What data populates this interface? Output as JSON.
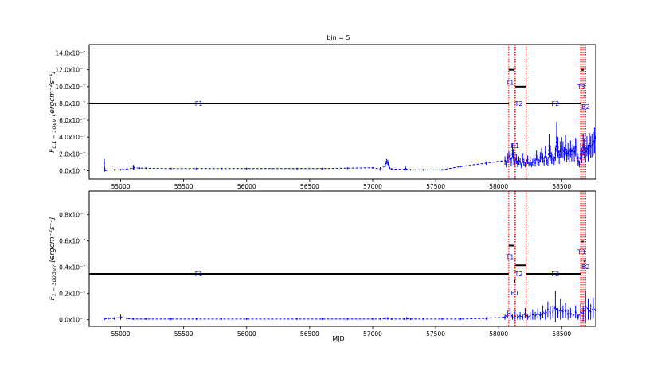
{
  "figure": {
    "title": "bin = 5",
    "xlabel": "MJD"
  },
  "colors": {
    "light_curve": "#0000ff",
    "flux_levels": "#000000",
    "period_markers": "#ff0000",
    "period_labels": "#0000ff",
    "background": "#ffffff"
  },
  "chart_data": [
    {
      "type": "line",
      "name": "top",
      "ylabel": "F_{0.1-1GeV} [erg cm^{-2} s^{-1}]",
      "ylabel_main": "F",
      "ylabel_sub": "0.1 − 1GeV",
      "ylabel_unit": "[ergcm⁻²s⁻¹]",
      "xlim": [
        54750,
        58770
      ],
      "ylim": [
        -1.0,
        15.0
      ],
      "y_scale_note": "×10⁻⁷",
      "yticks": [
        0,
        2,
        4,
        6,
        8,
        10,
        12,
        14
      ],
      "ytick_labels": [
        "0.0x10⁻⁷",
        "2.0x10⁻⁷",
        "4.0x10⁻⁷",
        "6.0x10⁻⁷",
        "8.0x10⁻⁷",
        "10.0x10⁻⁷",
        "12.0x10⁻⁷",
        "14.0x10⁻⁷"
      ],
      "xticks": [
        55000,
        55500,
        56000,
        56500,
        57000,
        57500,
        58000,
        58500
      ],
      "xtick_labels": [
        "55000",
        "55500",
        "56000",
        "56500",
        "57000",
        "57500",
        "58000",
        "58500"
      ],
      "levels": [
        {
          "label": "F1",
          "x0": 54750,
          "x1": 58080,
          "y": 8.0,
          "label_x": 55620,
          "label_y": 8.0
        },
        {
          "label": "T1",
          "x0": 58080,
          "x1": 58125,
          "y": 12.0,
          "label_x": 58090,
          "label_y": 10.5
        },
        {
          "label": "B1",
          "x0": 58125,
          "x1": 58132,
          "y": 5.0,
          "label_x": 58130,
          "label_y": 3.0
        },
        {
          "label": "T2",
          "x0": 58132,
          "x1": 58218,
          "y": 10.0,
          "label_x": 58160,
          "label_y": 8.0
        },
        {
          "label": "F2",
          "x0": 58218,
          "x1": 58650,
          "y": 8.0,
          "label_x": 58450,
          "label_y": 8.0
        },
        {
          "label": "T3",
          "x0": 58650,
          "x1": 58675,
          "y": 12.0,
          "label_x": 58655,
          "label_y": 10.0
        },
        {
          "label": "B2",
          "x0": 58675,
          "x1": 58690,
          "y": 8.9,
          "label_x": 58690,
          "label_y": 7.6
        }
      ],
      "vlines": [
        58080,
        58125,
        58132,
        58218,
        58650,
        58662,
        58675,
        58690
      ],
      "series": [
        {
          "style": "dashed-with-errorbars",
          "x": [
            54870,
            54872,
            54874,
            54880,
            54950,
            55000,
            55050,
            55100,
            55102,
            55104,
            55150,
            55200,
            55400,
            55600,
            55800,
            56000,
            56200,
            56400,
            56600,
            56800,
            57000,
            57060,
            57100,
            57110,
            57120,
            57125,
            57130,
            57135,
            57150,
            57250,
            57260,
            57270,
            57300,
            57400,
            57550,
            57700,
            57900,
            58050,
            58060,
            58070,
            58080,
            58090,
            58100,
            58110,
            58115,
            58120,
            58125,
            58130,
            58140,
            58150,
            58160,
            58170,
            58180,
            58190,
            58200,
            58210,
            58220,
            58230,
            58240,
            58250,
            58260,
            58270,
            58280,
            58290,
            58300,
            58310,
            58320,
            58330,
            58340,
            58350,
            58360,
            58370,
            58380,
            58390,
            58400,
            58410,
            58420,
            58430,
            58440,
            58450,
            58460,
            58470,
            58480,
            58490,
            58500,
            58510,
            58520,
            58530,
            58540,
            58550,
            58560,
            58570,
            58580,
            58590,
            58600,
            58610,
            58620,
            58630,
            58640,
            58650,
            58660,
            58670,
            58680,
            58690,
            58700,
            58710,
            58720,
            58730,
            58740,
            58750,
            58760,
            58770
          ],
          "y": [
            0.9,
            0.2,
            0.1,
            0.05,
            0.1,
            0.1,
            0.2,
            0.3,
            0.4,
            0.35,
            0.3,
            0.3,
            0.25,
            0.25,
            0.25,
            0.25,
            0.25,
            0.25,
            0.25,
            0.3,
            0.35,
            0.2,
            0.6,
            1.1,
            1.0,
            0.8,
            0.5,
            0.3,
            0.2,
            0.15,
            0.3,
            0.15,
            0.1,
            0.1,
            0.1,
            0.5,
            0.9,
            1.2,
            0.8,
            1.5,
            1.6,
            1.8,
            1.0,
            2.4,
            2.0,
            1.2,
            0.9,
            1.2,
            1.4,
            0.8,
            1.2,
            1.1,
            0.6,
            1.5,
            1.0,
            0.7,
            1.0,
            1.3,
            0.8,
            1.2,
            0.7,
            1.0,
            1.4,
            0.9,
            1.8,
            1.2,
            1.0,
            1.6,
            2.0,
            1.5,
            1.1,
            2.2,
            1.2,
            1.0,
            3.0,
            2.1,
            1.5,
            1.4,
            1.2,
            2.0,
            4.0,
            2.8,
            1.6,
            2.5,
            2.8,
            2.5,
            2.0,
            3.0,
            1.8,
            2.3,
            1.8,
            2.6,
            1.9,
            3.0,
            2.0,
            2.8,
            2.5,
            1.2,
            0.8,
            2.3,
            1.8,
            3.1,
            2.6,
            1.9,
            2.9,
            2.1,
            3.2,
            2.8,
            3.0,
            3.2,
            3.6,
            4.1
          ],
          "yerr": [
            0.5,
            0.3,
            0.2,
            0.1,
            0.1,
            0.1,
            0.1,
            0.2,
            0.3,
            0.2,
            0.1,
            0.1,
            0.1,
            0.1,
            0.1,
            0.1,
            0.1,
            0.1,
            0.1,
            0.1,
            0.1,
            0.2,
            0.2,
            0.3,
            0.3,
            0.2,
            0.2,
            0.1,
            0.1,
            0.1,
            0.3,
            0.1,
            0.1,
            0.1,
            0.1,
            0.1,
            0.2,
            0.5,
            0.4,
            0.6,
            0.7,
            0.6,
            0.5,
            0.8,
            0.6,
            0.5,
            0.4,
            0.5,
            0.6,
            0.4,
            0.5,
            0.4,
            0.3,
            0.6,
            0.4,
            0.3,
            0.4,
            0.5,
            0.3,
            0.5,
            0.3,
            0.4,
            0.5,
            0.4,
            0.6,
            0.5,
            0.4,
            0.6,
            0.7,
            0.6,
            0.5,
            0.7,
            0.5,
            0.4,
            1.4,
            0.9,
            0.7,
            0.6,
            0.5,
            0.8,
            1.8,
            1.2,
            0.8,
            1.0,
            1.2,
            1.0,
            0.8,
            1.2,
            0.8,
            1.0,
            0.8,
            1.0,
            0.8,
            1.2,
            0.9,
            1.1,
            1.2,
            0.6,
            0.4,
            1.0,
            0.9,
            1.3,
            1.2,
            0.9,
            1.2,
            1.0,
            1.3,
            1.3,
            1.4,
            1.4,
            1.5,
            1.6
          ]
        }
      ]
    },
    {
      "type": "line",
      "name": "bottom",
      "ylabel": "F_{1-300GeV} [erg cm^{-2} s^{-1}]",
      "ylabel_main": "F",
      "ylabel_sub": "1 − 300GeV",
      "ylabel_unit": "[ergcm⁻²s⁻¹]",
      "xlim": [
        54750,
        58770
      ],
      "ylim": [
        -0.05,
        0.98
      ],
      "y_scale_note": "×10⁻⁷",
      "yticks": [
        0.0,
        0.2,
        0.4,
        0.6,
        0.8
      ],
      "ytick_labels": [
        "0.0x10⁻⁷",
        "0.2x10⁻⁷",
        "0.4x10⁻⁷",
        "0.6x10⁻⁷",
        "0.8x10⁻⁷"
      ],
      "xticks": [
        55000,
        55500,
        56000,
        56500,
        57000,
        57500,
        58000,
        58500
      ],
      "xtick_labels": [
        "55000",
        "55500",
        "56000",
        "56500",
        "57000",
        "57500",
        "58000",
        "58500"
      ],
      "levels": [
        {
          "label": "F1",
          "x0": 54750,
          "x1": 58080,
          "y": 0.35,
          "label_x": 55620,
          "label_y": 0.35
        },
        {
          "label": "T1",
          "x0": 58080,
          "x1": 58125,
          "y": 0.565,
          "label_x": 58090,
          "label_y": 0.48
        },
        {
          "label": "B1",
          "x0": 58125,
          "x1": 58132,
          "y": 0.295,
          "label_x": 58130,
          "label_y": 0.205
        },
        {
          "label": "T2",
          "x0": 58132,
          "x1": 58218,
          "y": 0.415,
          "label_x": 58160,
          "label_y": 0.35
        },
        {
          "label": "F2",
          "x0": 58218,
          "x1": 58650,
          "y": 0.35,
          "label_x": 58450,
          "label_y": 0.35
        },
        {
          "label": "T3",
          "x0": 58650,
          "x1": 58675,
          "y": 0.595,
          "label_x": 58655,
          "label_y": 0.515
        },
        {
          "label": "B2",
          "x0": 58675,
          "x1": 58690,
          "y": 0.445,
          "label_x": 58690,
          "label_y": 0.405
        }
      ],
      "vlines": [
        58080,
        58125,
        58132,
        58218,
        58650,
        58662,
        58675,
        58690
      ],
      "series": [
        {
          "style": "dashed-with-errorbars",
          "x": [
            54870,
            54900,
            54950,
            55000,
            55050,
            55100,
            55200,
            55400,
            55600,
            55800,
            56000,
            56200,
            56400,
            56600,
            56800,
            57000,
            57060,
            57100,
            57120,
            57150,
            57250,
            57270,
            57300,
            57400,
            57550,
            57700,
            57900,
            58050,
            58070,
            58090,
            58110,
            58130,
            58150,
            58170,
            58190,
            58210,
            58230,
            58250,
            58270,
            58290,
            58310,
            58330,
            58350,
            58370,
            58390,
            58410,
            58430,
            58450,
            58470,
            58490,
            58510,
            58530,
            58550,
            58570,
            58590,
            58610,
            58630,
            58650,
            58670,
            58690,
            58710,
            58730,
            58750,
            58770
          ],
          "y": [
            0.005,
            0.01,
            0.01,
            0.02,
            0.01,
            0.005,
            0.005,
            0.005,
            0.005,
            0.005,
            0.005,
            0.005,
            0.005,
            0.005,
            0.005,
            0.005,
            0.005,
            0.01,
            0.01,
            0.005,
            0.005,
            0.01,
            0.005,
            0.005,
            0.005,
            0.005,
            0.01,
            0.02,
            0.04,
            0.05,
            0.02,
            0.03,
            0.02,
            0.03,
            0.02,
            0.05,
            0.02,
            0.03,
            0.04,
            0.03,
            0.05,
            0.03,
            0.06,
            0.04,
            0.08,
            0.05,
            0.06,
            0.1,
            0.05,
            0.08,
            0.06,
            0.07,
            0.04,
            0.05,
            0.03,
            0.06,
            0.02,
            0.06,
            0.05,
            0.1,
            0.08,
            0.06,
            0.09,
            0.07
          ],
          "yerr": [
            0.01,
            0.01,
            0.01,
            0.02,
            0.01,
            0.005,
            0.005,
            0.005,
            0.005,
            0.005,
            0.005,
            0.005,
            0.005,
            0.005,
            0.005,
            0.005,
            0.005,
            0.01,
            0.01,
            0.005,
            0.005,
            0.01,
            0.005,
            0.005,
            0.005,
            0.005,
            0.01,
            0.02,
            0.03,
            0.04,
            0.02,
            0.03,
            0.02,
            0.03,
            0.02,
            0.04,
            0.02,
            0.03,
            0.04,
            0.03,
            0.04,
            0.03,
            0.05,
            0.04,
            0.06,
            0.05,
            0.05,
            0.12,
            0.04,
            0.08,
            0.05,
            0.06,
            0.04,
            0.04,
            0.03,
            0.05,
            0.02,
            0.06,
            0.06,
            0.12,
            0.08,
            0.06,
            0.08,
            0.06
          ]
        }
      ]
    }
  ]
}
